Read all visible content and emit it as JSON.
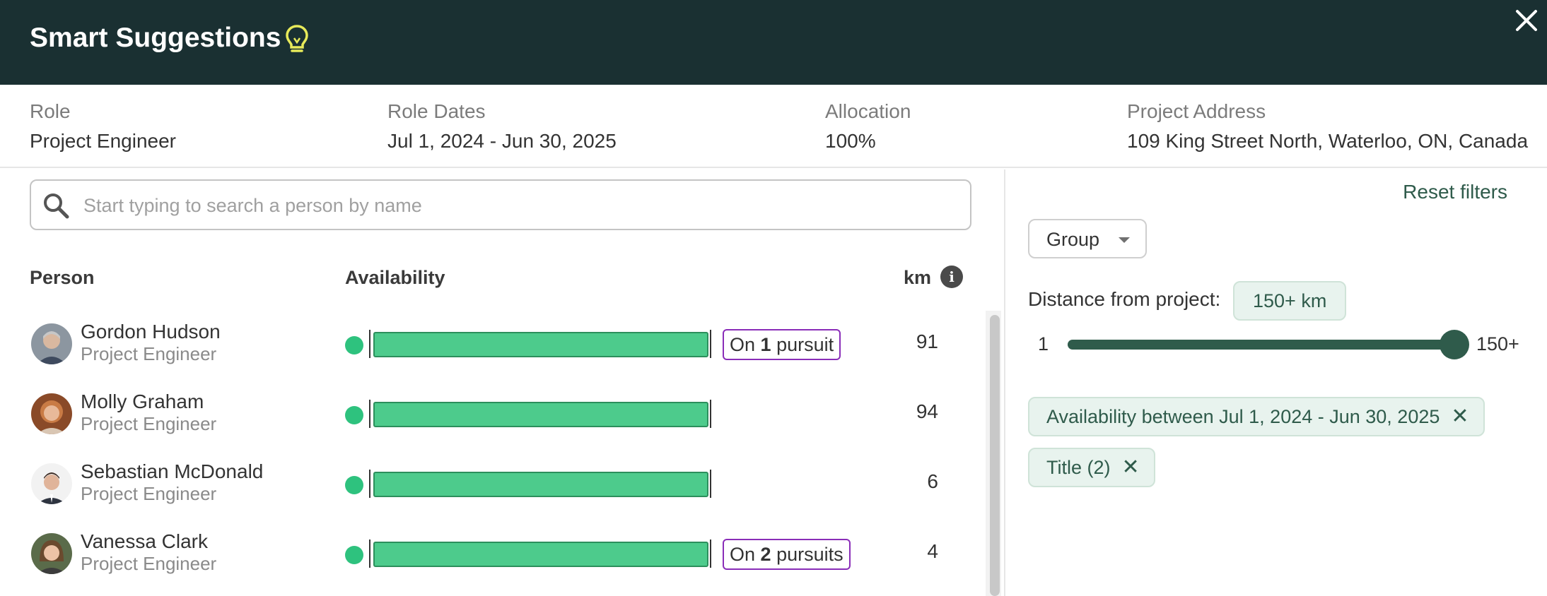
{
  "header": {
    "title": "Smart Suggestions"
  },
  "info": {
    "role_label": "Role",
    "role_value": "Project Engineer",
    "dates_label": "Role Dates",
    "dates_value": "Jul 1, 2024 - Jun 30, 2025",
    "allocation_label": "Allocation",
    "allocation_value": "100%",
    "address_label": "Project Address",
    "address_value": "109 King Street North, Waterloo, ON, Canada"
  },
  "search": {
    "placeholder": "Start typing to search a person by name"
  },
  "table": {
    "headers": {
      "person": "Person",
      "availability": "Availability",
      "km": "km"
    },
    "rows": [
      {
        "name": "Gordon Hudson",
        "title": "Project Engineer",
        "availability": 1.0,
        "pursuit_prefix": "On ",
        "pursuit_count": "1",
        "pursuit_suffix": " pursuit",
        "km": "91"
      },
      {
        "name": "Molly Graham",
        "title": "Project Engineer",
        "availability": 1.0,
        "km": "94"
      },
      {
        "name": "Sebastian McDonald",
        "title": "Project Engineer",
        "availability": 1.0,
        "km": "6"
      },
      {
        "name": "Vanessa Clark",
        "title": "Project Engineer",
        "availability": 1.0,
        "pursuit_prefix": "On ",
        "pursuit_count": "2",
        "pursuit_suffix": " pursuits",
        "km": "4"
      }
    ]
  },
  "filters": {
    "reset_label": "Reset filters",
    "group_label": "Group",
    "distance_label": "Distance from project:",
    "distance_value": "150+ km",
    "slider_min": "1",
    "slider_max": "150+",
    "slider_level": 1.0,
    "chips": [
      {
        "label": "Availability between Jul 1, 2024 - Jun 30, 2025"
      },
      {
        "label": "Title (2)"
      }
    ]
  },
  "colors": {
    "header_bg": "#1a3032",
    "accent": "#2f5b4b",
    "availability_bar": "#4dcb8c",
    "pursuit_border": "#8a2db8",
    "bulb": "#e7ea5a"
  }
}
